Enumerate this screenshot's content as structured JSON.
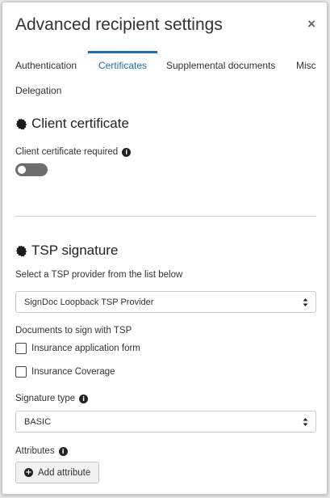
{
  "dialog": {
    "title": "Advanced recipient settings",
    "close_label": "×"
  },
  "tabs": [
    {
      "label": "Authentication",
      "active": false
    },
    {
      "label": "Certificates",
      "active": true
    },
    {
      "label": "Supplemental documents",
      "active": false
    },
    {
      "label": "Misc",
      "active": false
    },
    {
      "label": "Delegation",
      "active": false
    }
  ],
  "client_certificate": {
    "heading": "Client certificate",
    "required_label": "Client certificate required",
    "required_toggle_on": false
  },
  "tsp_signature": {
    "heading": "TSP signature",
    "provider_label": "Select a TSP provider from the list below",
    "provider_selected": "SignDoc Loopback TSP Provider",
    "documents_label": "Documents to sign with TSP",
    "documents": [
      {
        "label": "Insurance application form",
        "checked": false
      },
      {
        "label": "Insurance Coverage",
        "checked": false
      }
    ],
    "signature_type_label": "Signature type",
    "signature_type_selected": "BASIC",
    "attributes_label": "Attributes",
    "add_attribute_label": "Add attribute"
  },
  "colors": {
    "accent": "#1f6fae",
    "toggle_off": "#6e6e6e"
  },
  "icons": {
    "section": "seal-icon",
    "info": "info-icon",
    "add": "plus-circle-icon",
    "select_caret": "sort-caret-icon"
  }
}
